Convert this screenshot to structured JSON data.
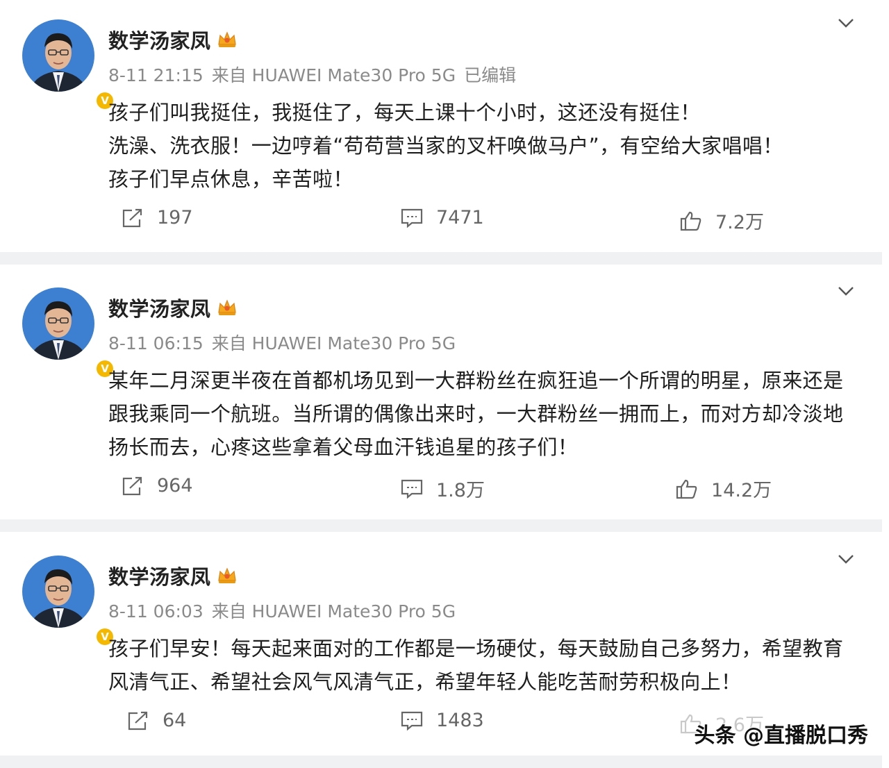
{
  "posts": [
    {
      "author": "数学汤家凤",
      "time": "8-11 21:15",
      "source": "来自 HUAWEI Mate30 Pro 5G",
      "edited": "已编辑",
      "lines": [
        "孩子们叫我挺住，我挺住了，每天上课十个小时，这还没有挺住！",
        "洗澡、洗衣服！一边哼着“苟苟营当家的叉杆唤做马户”，有空给大家唱唱！",
        "孩子们早点休息，辛苦啦！"
      ],
      "reposts": "197",
      "comments": "7471",
      "likes": "7.2万"
    },
    {
      "author": "数学汤家凤",
      "time": "8-11 06:15",
      "source": "来自 HUAWEI Mate30 Pro 5G",
      "edited": "",
      "lines": [
        "某年二月深更半夜在首都机场见到一大群粉丝在疯狂追一个所谓的明星，原来还是",
        "跟我乘同一个航班。当所谓的偶像出来时，一大群粉丝一拥而上，而对方却冷淡地",
        "扬长而去，心疼这些拿着父母血汗钱追星的孩子们！"
      ],
      "reposts": "964",
      "comments": "1.8万",
      "likes": "14.2万"
    },
    {
      "author": "数学汤家凤",
      "time": "8-11 06:03",
      "source": "来自 HUAWEI Mate30 Pro 5G",
      "edited": "",
      "lines": [
        "孩子们早安！每天起来面对的工作都是一场硬仗，每天鼓励自己多努力，希望教育",
        "风清气正、希望社会风气风清气正，希望年轻人能吃苦耐劳积极向上！"
      ],
      "reposts": "64",
      "comments": "1483",
      "likes": "2.6万"
    }
  ],
  "badge": "V",
  "watermark": "头条 @直播脱口秀",
  "colors": {
    "meta": "#8a8a8a",
    "separator": "#f0f1f3",
    "badge": "#f5b800",
    "crown": "#f4a81c"
  }
}
